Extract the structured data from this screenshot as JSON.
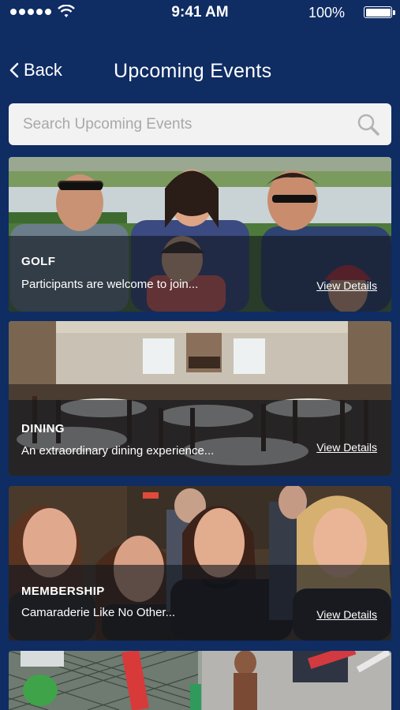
{
  "status": {
    "time": "9:41 AM",
    "battery": "100%"
  },
  "nav": {
    "back_label": "Back",
    "title": "Upcoming Events"
  },
  "search": {
    "placeholder": "Search Upcoming Events"
  },
  "events": [
    {
      "title": "GOLF",
      "description": "Participants are welcome to join...",
      "link": "View Details"
    },
    {
      "title": "DINING",
      "description": "An extraordinary dining experience...",
      "link": "View Details"
    },
    {
      "title": "MEMBERSHIP",
      "description": "Camaraderie Like No Other...",
      "link": "View Details"
    }
  ]
}
